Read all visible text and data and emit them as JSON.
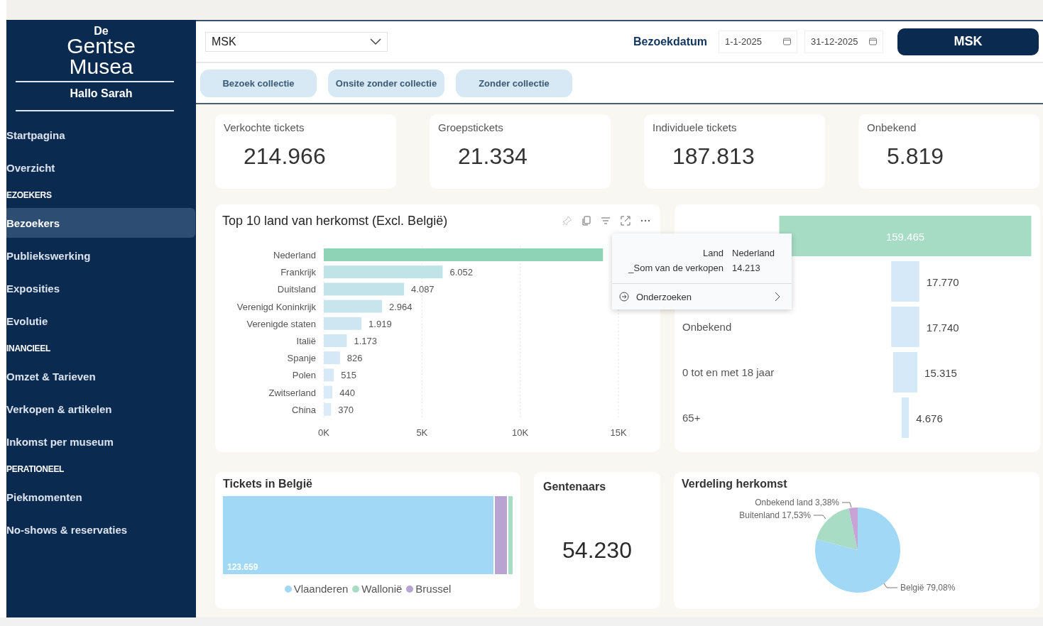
{
  "sidebar": {
    "logo": [
      "De",
      "Gentse",
      "Musea"
    ],
    "greeting": "Hallo Sarah",
    "items": [
      {
        "kind": "item",
        "label": "Startpagina",
        "selected": false
      },
      {
        "kind": "item",
        "label": "Overzicht",
        "selected": false
      },
      {
        "kind": "section",
        "label": "EZOEKERS"
      },
      {
        "kind": "item",
        "label": "Bezoekers",
        "selected": true
      },
      {
        "kind": "item",
        "label": "Publiekswerking",
        "selected": false
      },
      {
        "kind": "item",
        "label": "Exposities",
        "selected": false
      },
      {
        "kind": "item",
        "label": "Evolutie",
        "selected": false
      },
      {
        "kind": "section",
        "label": "INANCIEEL"
      },
      {
        "kind": "item",
        "label": "Omzet & Tarieven",
        "selected": false
      },
      {
        "kind": "item",
        "label": "Verkopen & artikelen",
        "selected": false
      },
      {
        "kind": "item",
        "label": "Inkomst per museum",
        "selected": false
      },
      {
        "kind": "section",
        "label": "PERATIONEEL"
      },
      {
        "kind": "item",
        "label": "Piekmomenten",
        "selected": false
      },
      {
        "kind": "item",
        "label": "No-shows & reservaties",
        "selected": false
      }
    ]
  },
  "header": {
    "museum_select": {
      "value": "MSK"
    },
    "date_label": "Bezoekdatum",
    "date_from": "1-1-2025",
    "date_to": "31-12-2025",
    "museum_button": "MSK"
  },
  "tabs": [
    "Bezoek collectie",
    "Onsite zonder collectie",
    "Zonder collectie"
  ],
  "kpis": [
    {
      "label": "Verkochte tickets",
      "value": "214.966"
    },
    {
      "label": "Groepstickets",
      "value": "21.334"
    },
    {
      "label": "Individuele tickets",
      "value": "187.813"
    },
    {
      "label": "Onbekend",
      "value": "5.819"
    }
  ],
  "countries": {
    "title": "Top 10 land van herkomst (Excl. België)",
    "chart_data": {
      "type": "bar",
      "orientation": "horizontal",
      "categories": [
        "Nederland",
        "Frankrijk",
        "Duitsland",
        "Verenigd Koninkrijk",
        "Verenigde staten",
        "Italië",
        "Spanje",
        "Polen",
        "Zwitserland",
        "China"
      ],
      "values": [
        14213,
        6052,
        4087,
        2964,
        1919,
        1173,
        826,
        515,
        440,
        370
      ],
      "value_labels": [
        null,
        "6.052",
        "4.087",
        "2.964",
        "1.919",
        "1.173",
        "826",
        "515",
        "440",
        "370"
      ],
      "xlim": [
        0,
        15000
      ],
      "xticks": [
        {
          "value": 0,
          "label": "0K"
        },
        {
          "value": 5000,
          "label": "5K"
        },
        {
          "value": 10000,
          "label": "10K"
        },
        {
          "value": 15000,
          "label": "15K"
        }
      ]
    }
  },
  "tooltip": {
    "rows": [
      {
        "key": "Land",
        "value": "Nederland"
      },
      {
        "key": "_Som van de verkopen",
        "value": "14.213"
      }
    ],
    "action": "Onderzoeken"
  },
  "age_groups": {
    "rows": [
      {
        "value": "159.465"
      },
      {
        "value": "17.770"
      },
      {
        "label": "Onbekend",
        "value": "17.740"
      },
      {
        "label": "0 tot en met 18 jaar",
        "value": "15.315"
      },
      {
        "label": "65+",
        "value": "4.676"
      }
    ]
  },
  "belgium": {
    "title": "Tickets in België",
    "value_label": "123.659",
    "legend": [
      {
        "name": "Vlaanderen",
        "color": "#a0d8f5"
      },
      {
        "name": "Wallonië",
        "color": "#a8dcc4"
      },
      {
        "name": "Brussel",
        "color": "#b9a3d0"
      }
    ]
  },
  "gentenaars": {
    "title": "Gentenaars",
    "value": "54.230"
  },
  "origin": {
    "title": "Verdeling herkomst",
    "chart_data": {
      "type": "pie",
      "categories": [
        "België",
        "Buitenland",
        "Onbekend land"
      ],
      "values": [
        79.08,
        17.53,
        3.38
      ],
      "colors": [
        "#a0d8f5",
        "#a8dcc4",
        "#c7a3d6"
      ],
      "value_labels": [
        "79,08%",
        "17,53%",
        "3,38%"
      ]
    }
  }
}
